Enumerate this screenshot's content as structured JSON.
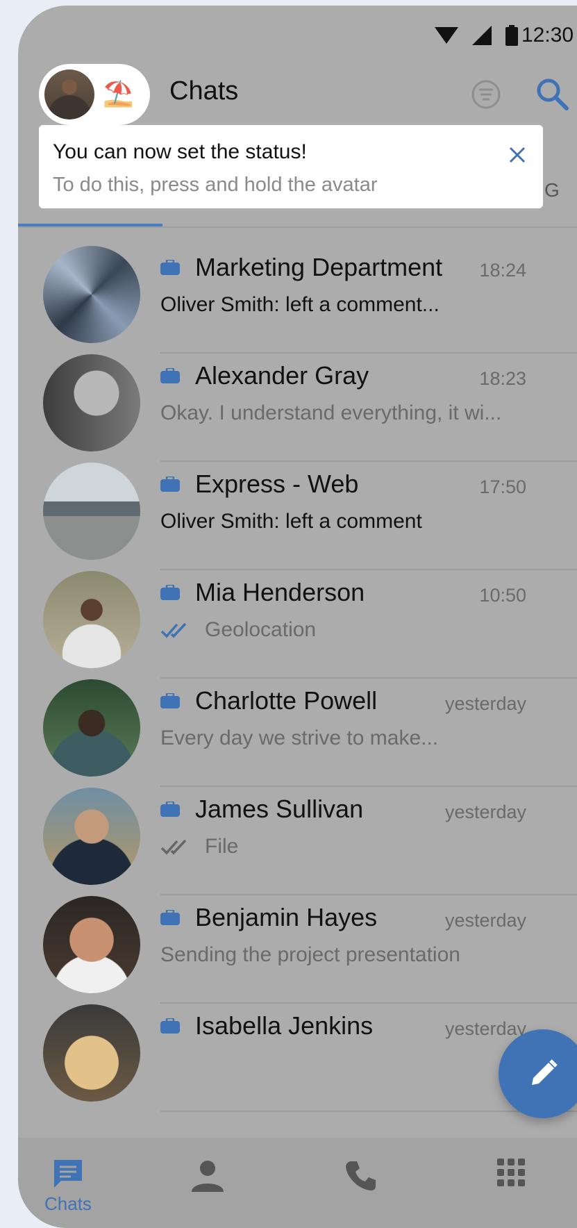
{
  "status_bar": {
    "time": "12:30"
  },
  "header": {
    "title": "Chats",
    "status_emoji": "⛱️"
  },
  "tooltip": {
    "title": "You can now set the status!",
    "subtitle": "To do this, press and hold the avatar"
  },
  "tabs": {
    "partial_label": "G"
  },
  "chats": [
    {
      "name": "Marketing Department",
      "time": "18:24",
      "sender": "Oliver Smith:",
      "message": " left a comment...",
      "check": ""
    },
    {
      "name": "Alexander Gray",
      "time": "18:23",
      "sender": "",
      "message": "Okay. I understand everything, it wi...",
      "check": ""
    },
    {
      "name": "Express - Web",
      "time": "17:50",
      "sender": "Oliver Smith:",
      "message": " left a comment",
      "check": ""
    },
    {
      "name": "Mia Henderson",
      "time": "10:50",
      "sender": "",
      "message": "Geolocation",
      "check": "read"
    },
    {
      "name": "Charlotte Powell",
      "time": "yesterday",
      "sender": "",
      "message": "Every day we strive to make...",
      "check": ""
    },
    {
      "name": "James Sullivan",
      "time": "yesterday",
      "sender": "",
      "message": "File",
      "check": "sent"
    },
    {
      "name": "Benjamin Hayes",
      "time": "yesterday",
      "sender": "",
      "message": "Sending the project presentation",
      "check": ""
    },
    {
      "name": "Isabella Jenkins",
      "time": "yesterday",
      "sender": "",
      "message": "",
      "check": ""
    }
  ],
  "bottom_nav": {
    "chats_label": "Chats",
    "items": [
      "chats-icon",
      "contacts-icon",
      "phone-icon",
      "apps-grid-icon"
    ]
  },
  "colors": {
    "accent": "#3f73b5",
    "overlay": "#acacac",
    "tooltip_bg": "#ffffff"
  }
}
